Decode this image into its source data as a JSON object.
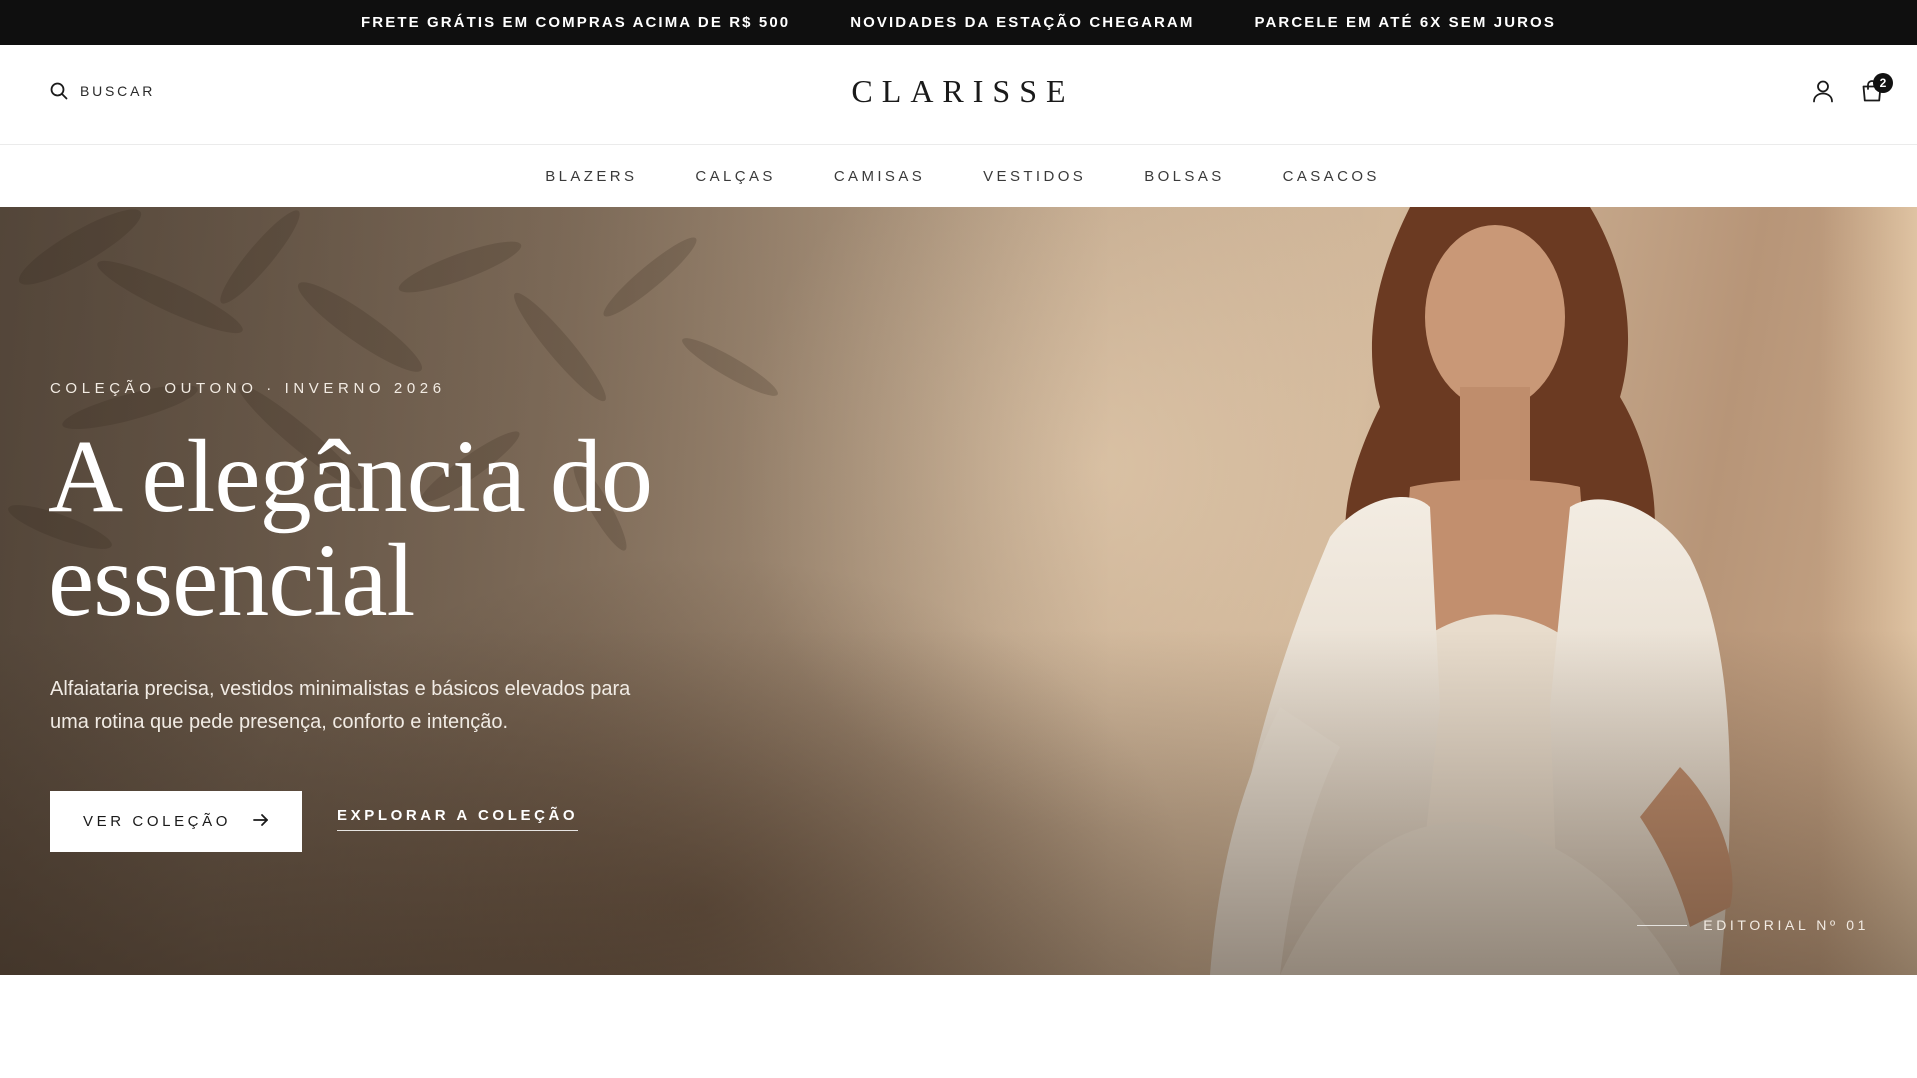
{
  "announcement": {
    "items": [
      "FRETE GRÁTIS EM COMPRAS ACIMA DE R$ 500",
      "NOVIDADES DA ESTAÇÃO CHEGARAM",
      "PARCELE EM ATÉ 6X SEM JUROS"
    ]
  },
  "header": {
    "search_label": "BUSCAR",
    "logo": "CLARISSE",
    "cart_count": "2",
    "icons": {
      "search": "search-icon",
      "account": "user-icon",
      "cart": "shopping-bag-icon"
    }
  },
  "nav": {
    "items": [
      "BLAZERS",
      "CALÇAS",
      "CAMISAS",
      "VESTIDOS",
      "BOLSAS",
      "CASACOS"
    ]
  },
  "hero": {
    "eyebrow": "COLEÇÃO OUTONO · INVERNO 2026",
    "title_line1": "A elegância do",
    "title_line2": "essencial",
    "subtitle_line1": "Alfaiataria precisa, vestidos minimalistas e básicos elevados para",
    "subtitle_line2": "uma rotina que pede presença, conforto e intenção.",
    "cta_primary": "VER COLEÇÃO",
    "cta_primary_icon": "arrow-right-icon",
    "cta_secondary": "EXPLORAR A COLEÇÃO",
    "editorial_label": "EDITORIAL Nº 01"
  },
  "colors": {
    "announcement_bg": "#0f0f0f",
    "text_dark": "#1a1a1a",
    "hero_text": "#ffffff"
  }
}
